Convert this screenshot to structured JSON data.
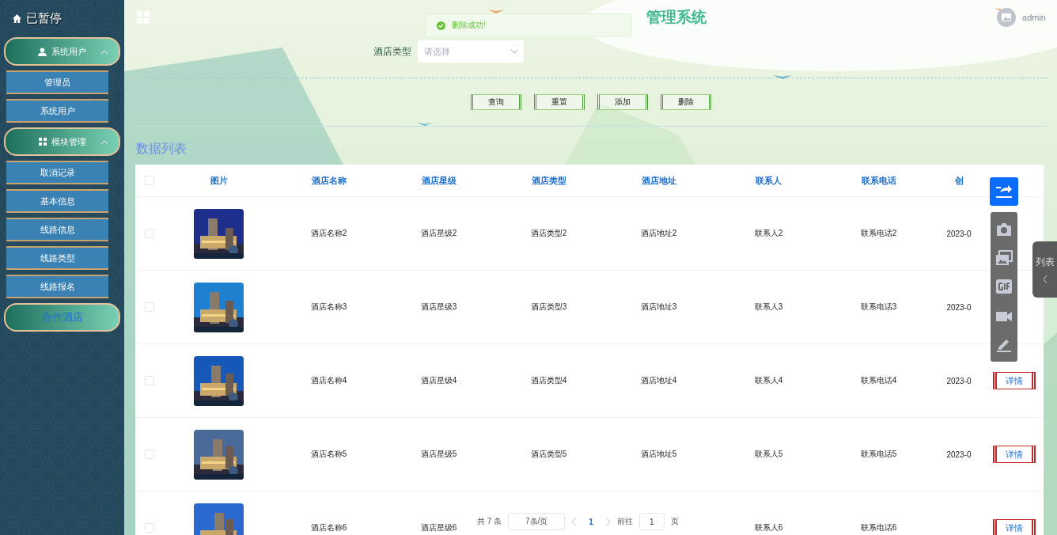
{
  "sidebar": {
    "title": "已暂停",
    "menu": [
      {
        "kind": "group",
        "label": "系统用户",
        "selected": false,
        "expanded": true,
        "children": [
          {
            "label": "管理员"
          },
          {
            "label": "系统用户"
          }
        ]
      },
      {
        "kind": "group",
        "label": "模块管理",
        "selected": false,
        "expanded": true,
        "children": [
          {
            "label": "取消记录"
          },
          {
            "label": "基本信息"
          },
          {
            "label": "线路信息"
          },
          {
            "label": "线路类型"
          },
          {
            "label": "线路报名"
          }
        ]
      },
      {
        "kind": "link",
        "label": "合作酒店",
        "selected": true
      }
    ]
  },
  "header": {
    "title": "管理系统",
    "user": "admin"
  },
  "toast": {
    "message": "删除成功!"
  },
  "filter": {
    "label": "酒店类型",
    "placeholder": "请选择"
  },
  "actions": [
    "查询",
    "重置",
    "添加",
    "删除"
  ],
  "section_title": "数据列表",
  "table": {
    "select_all": {
      "checked": false
    },
    "columns": [
      "图片",
      "酒店名称",
      "酒店星级",
      "酒店类型",
      "酒店地址",
      "联系人",
      "联系电话",
      "创"
    ],
    "rows": [
      {
        "checked": false,
        "name": "酒店名称2",
        "star": "酒店星级2",
        "type": "酒店类型2",
        "address": "酒店地址2",
        "contact": "联系人2",
        "phone": "联系电话2",
        "created": "2023-0"
      },
      {
        "checked": false,
        "name": "酒店名称3",
        "star": "酒店星级3",
        "type": "酒店类型3",
        "address": "酒店地址3",
        "contact": "联系人3",
        "phone": "联系电话3",
        "created": "2023-0"
      },
      {
        "checked": false,
        "name": "酒店名称4",
        "star": "酒店星级4",
        "type": "酒店类型4",
        "address": "酒店地址4",
        "contact": "联系人4",
        "phone": "联系电话4",
        "created": "2023-0",
        "action": "详情"
      },
      {
        "checked": false,
        "name": "酒店名称5",
        "star": "酒店星级5",
        "type": "酒店类型5",
        "address": "酒店地址5",
        "contact": "联系人5",
        "phone": "联系电话5",
        "created": "2023-0",
        "action": "详情"
      },
      {
        "checked": false,
        "name": "酒店名称6",
        "star": "酒店星级6",
        "contact": "联系人6",
        "phone": "联系电话6",
        "action": "详情"
      }
    ]
  },
  "pagination": {
    "total": "共 7 条",
    "page_size": "7条/页",
    "pages": [
      {
        "label": "1",
        "selected": true
      }
    ],
    "goto_label": "前往",
    "goto_value": "1",
    "goto_suffix": "页"
  },
  "side_tab": {
    "label": "列表"
  }
}
